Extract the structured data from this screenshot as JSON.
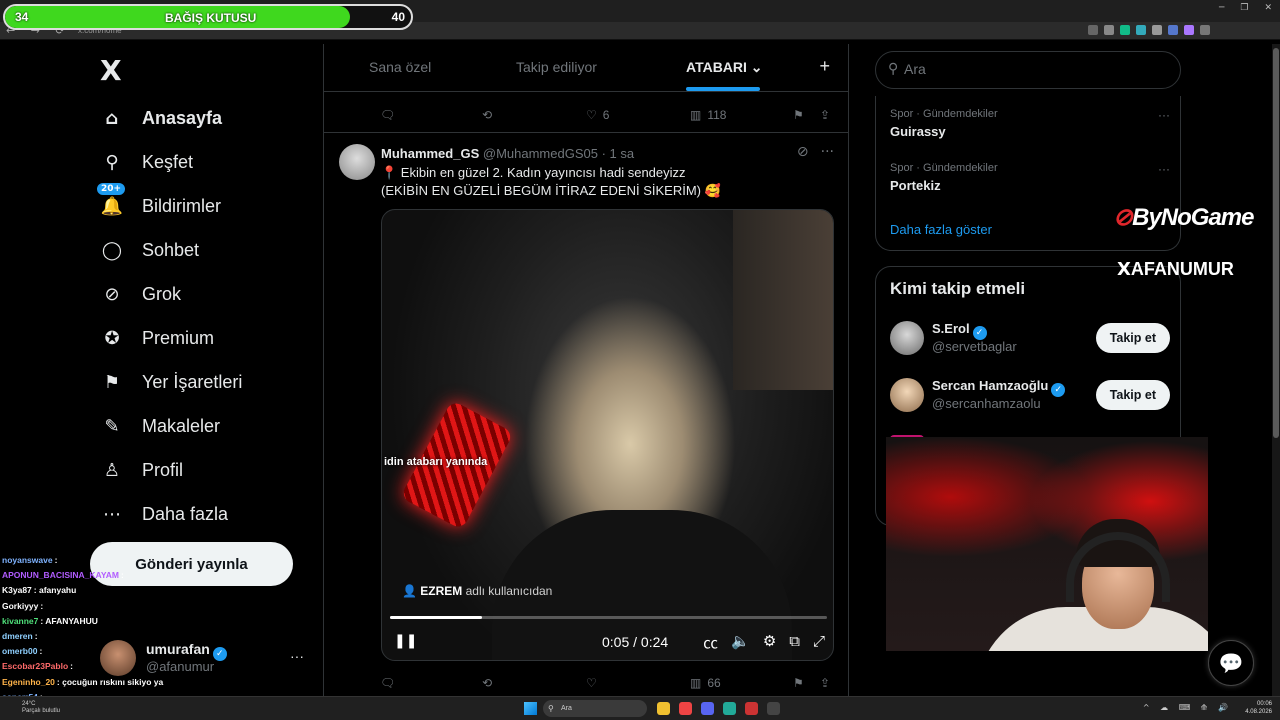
{
  "browser": {
    "url": "x.com/home",
    "nav_glyphs": "← → ⟳"
  },
  "donation": {
    "title": "BAĞIŞ KUTUSU",
    "current": "34",
    "goal": "40",
    "progress": 0.85,
    "fill_color": "#3fd81e"
  },
  "sidebar": {
    "logo": "X",
    "items": [
      {
        "label": "Anasayfa",
        "icon": "home-icon",
        "glyph": "⌂"
      },
      {
        "label": "Keşfet",
        "icon": "search-icon",
        "glyph": "⚲"
      },
      {
        "label": "Bildirimler",
        "icon": "bell-icon",
        "glyph": "🔔",
        "badge": "20+"
      },
      {
        "label": "Sohbet",
        "icon": "chat-icon",
        "glyph": "◯"
      },
      {
        "label": "Grok",
        "icon": "grok-icon",
        "glyph": "⊘"
      },
      {
        "label": "Premium",
        "icon": "premium-icon",
        "glyph": "✪"
      },
      {
        "label": "Yer İşaretleri",
        "icon": "bookmark-icon",
        "glyph": "⚑"
      },
      {
        "label": "Makaleler",
        "icon": "article-icon",
        "glyph": "✎"
      },
      {
        "label": "Profil",
        "icon": "profile-icon",
        "glyph": "♙"
      },
      {
        "label": "Daha fazla",
        "icon": "more-icon",
        "glyph": "⋯"
      }
    ],
    "post_button": "Gönderi yayınla"
  },
  "chat": [
    {
      "user": "noyanswave",
      "color": "#7fb3ff",
      "msg": ""
    },
    {
      "user": "APONUN_BACISINA_KAYAM",
      "color": "#b15cff",
      "msg": ""
    },
    {
      "user": "K3ya87",
      "color": "#ffffff",
      "msg": "afanyahu"
    },
    {
      "user": "Gorkiyyy",
      "color": "#ffffff",
      "msg": ""
    },
    {
      "user": "kivanne7",
      "color": "#4fe07a",
      "msg": "AFANYAHUU"
    },
    {
      "user": "dmeren",
      "color": "#8fd0ff",
      "msg": ""
    },
    {
      "user": "omerb00",
      "color": "#8fd0ff",
      "msg": ""
    },
    {
      "user": "Escobar23Pablo",
      "color": "#ff6a6a",
      "msg": ""
    },
    {
      "user": "Egeninho_20",
      "color": "#ffb44a",
      "msg": "çocuğun rıskını sikiyo ya"
    },
    {
      "user": "sonerr54",
      "color": "#7fb3ff",
      "msg": ""
    }
  ],
  "account": {
    "name": "umurafan",
    "handle": "@afanumur",
    "more": "···"
  },
  "tabs": [
    {
      "label": "Sana özel"
    },
    {
      "label": "Takip ediliyor"
    },
    {
      "label": "ATABARI ⌄"
    }
  ],
  "tabs_plus": "+",
  "prev_tweet_actions": {
    "reply": "",
    "retweet": "",
    "like": "6",
    "views": "118"
  },
  "tweet": {
    "name": "Muhammed_GS",
    "handle": "@MuhammedGS05",
    "time": "· 1 sa",
    "line1": "📍 Ekibin en güzel 2. Kadın yayıncısı hadi sendeyizz",
    "line2": "(EKİBİN EN GÜZELİ BEGÜM İTİRAZ EDENİ SİKERİM) 🥰",
    "video": {
      "caption": "idin atabarı yanında",
      "credit_user": "EZREM",
      "credit_suffix": " adlı kullanıcıdan",
      "time": "0:05 / 0:24",
      "progress": 0.21
    },
    "actions": {
      "reply": "",
      "retweet": "",
      "like": "",
      "views": "66"
    }
  },
  "search": {
    "placeholder": "Ara"
  },
  "trends": [
    {
      "category": "Spor · Gündemdekiler",
      "name": "Guirassy"
    },
    {
      "category": "Spor · Gündemdekiler",
      "name": "Portekiz"
    }
  ],
  "trends_more": "···",
  "show_more": "Daha fazla göster",
  "who_to_follow": {
    "title": "Kimi takip etmeli",
    "follow_label": "Takip et",
    "users": [
      {
        "name": "S.Erol",
        "handle": "@servetbaglar"
      },
      {
        "name": "Sercan Hamzaoğlu",
        "handle": "@sercanhamzaolu"
      }
    ],
    "partial": "D"
  },
  "overlays": {
    "bynogame": "ByNoGame",
    "afanumur": "AFANUMUR",
    "x_mark": "X"
  },
  "taskbar": {
    "weather_temp": "24°C",
    "weather_desc": "Parçalı bulutlu",
    "search": "Ara",
    "time": "00:06",
    "date": "4.08.2026"
  },
  "colors": {
    "accent": "#1d9bf0",
    "bg": "#000000",
    "border": "#2f3336"
  }
}
